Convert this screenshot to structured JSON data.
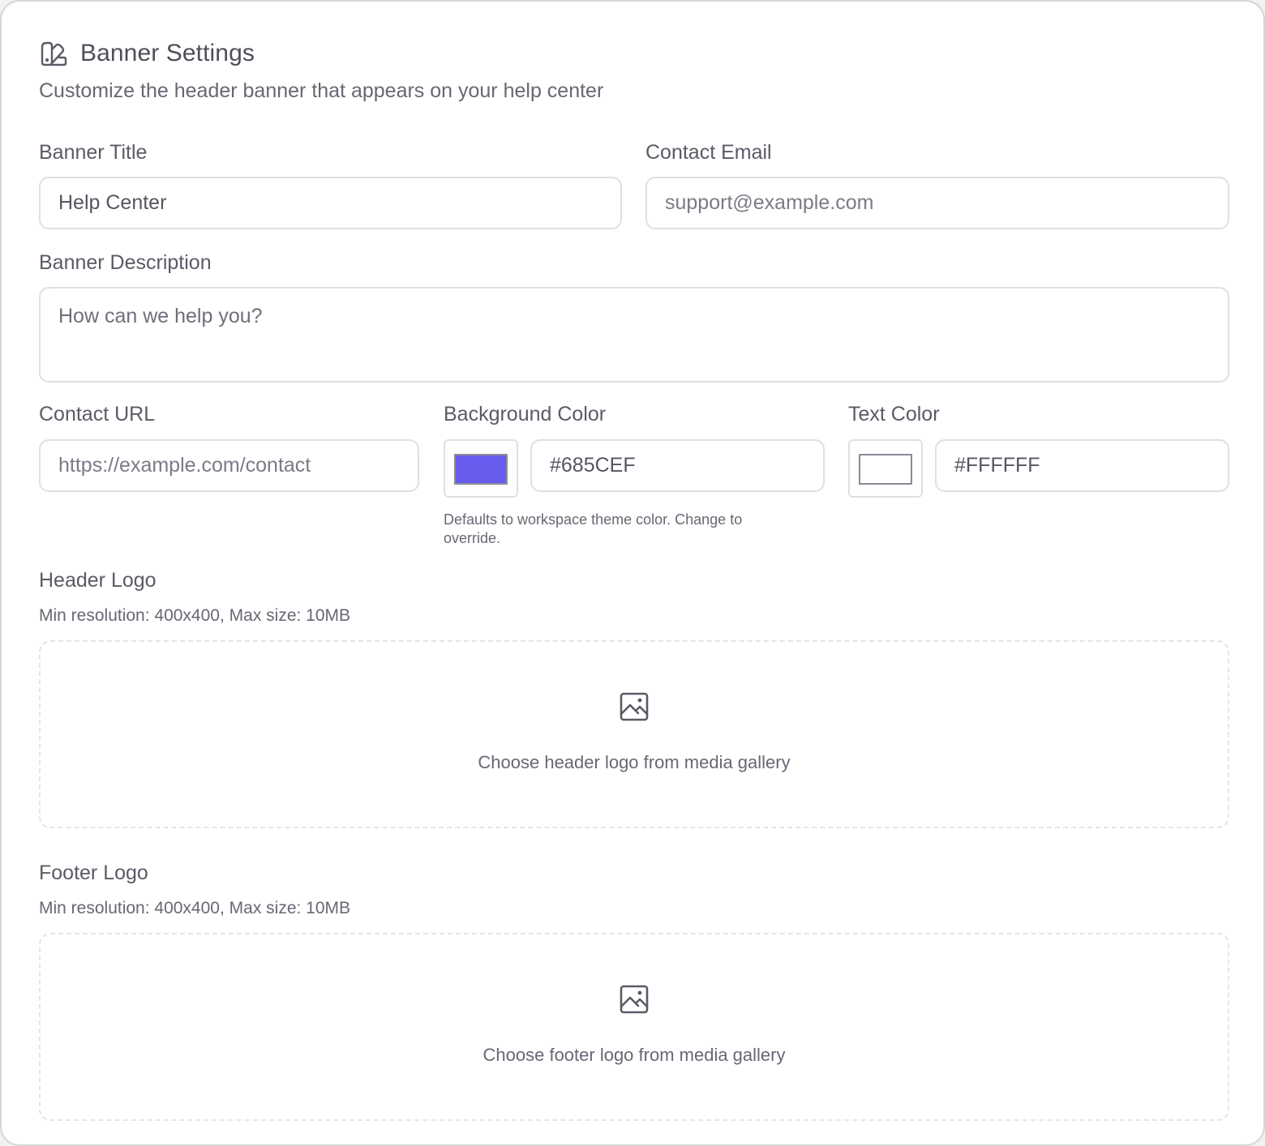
{
  "header": {
    "title": "Banner Settings",
    "subtitle": "Customize the header banner that appears on your help center",
    "icon": "banner-edit-icon"
  },
  "fields": {
    "banner_title": {
      "label": "Banner Title",
      "value": "Help Center"
    },
    "contact_email": {
      "label": "Contact Email",
      "placeholder": "support@example.com"
    },
    "banner_description": {
      "label": "Banner Description",
      "placeholder": "How can we help you?"
    },
    "contact_url": {
      "label": "Contact URL",
      "placeholder": "https://example.com/contact"
    },
    "background_color": {
      "label": "Background Color",
      "value": "#685CEF",
      "hint": "Defaults to workspace theme color. Change to override."
    },
    "text_color": {
      "label": "Text Color",
      "value": "#FFFFFF"
    }
  },
  "header_logo": {
    "label": "Header Logo",
    "requirements": "Min resolution: 400x400, Max size: 10MB",
    "dropzone_text": "Choose header logo from media gallery",
    "icon": "image-icon"
  },
  "footer_logo": {
    "label": "Footer Logo",
    "requirements": "Min resolution: 400x400, Max size: 10MB",
    "dropzone_text": "Choose footer logo from media gallery",
    "icon": "image-icon"
  },
  "colors": {
    "background_swatch": "#685CEF",
    "text_swatch": "#FFFFFF",
    "border": "#dfe0e4"
  }
}
